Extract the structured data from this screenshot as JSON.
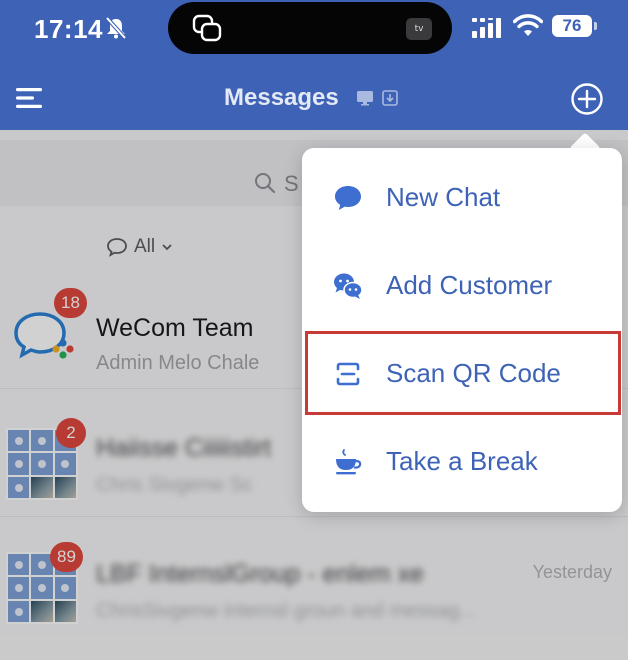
{
  "status_bar": {
    "time": "17:14",
    "battery": "76",
    "tv_label": "tv"
  },
  "header": {
    "title": "Messages"
  },
  "search": {
    "placeholder": "S"
  },
  "filter": {
    "label": "All"
  },
  "chats": [
    {
      "name": "WeCom Team",
      "preview": "Admin Melo Chale",
      "badge": "18"
    },
    {
      "name": "Haiisse Ciiiiistirt",
      "preview": "Chris Sivgenw Sc",
      "badge": "2"
    },
    {
      "name": "LBF InternslGroup - enlem xe",
      "preview": "ChrisSivgenw internsl groun and messag...",
      "badge": "89",
      "time": "Yesterday"
    }
  ],
  "popup_menu": {
    "items": [
      {
        "label": "New Chat",
        "icon": "chat-bubble-icon"
      },
      {
        "label": "Add Customer",
        "icon": "wechat-icon"
      },
      {
        "label": "Scan QR Code",
        "icon": "scan-icon"
      },
      {
        "label": "Take a Break",
        "icon": "coffee-cup-icon"
      }
    ],
    "highlighted": "Scan QR Code"
  },
  "colors": {
    "header_bg": "#3e63b6",
    "accent": "#3e63b6",
    "badge": "#e0493d",
    "highlight": "#c83a35"
  }
}
